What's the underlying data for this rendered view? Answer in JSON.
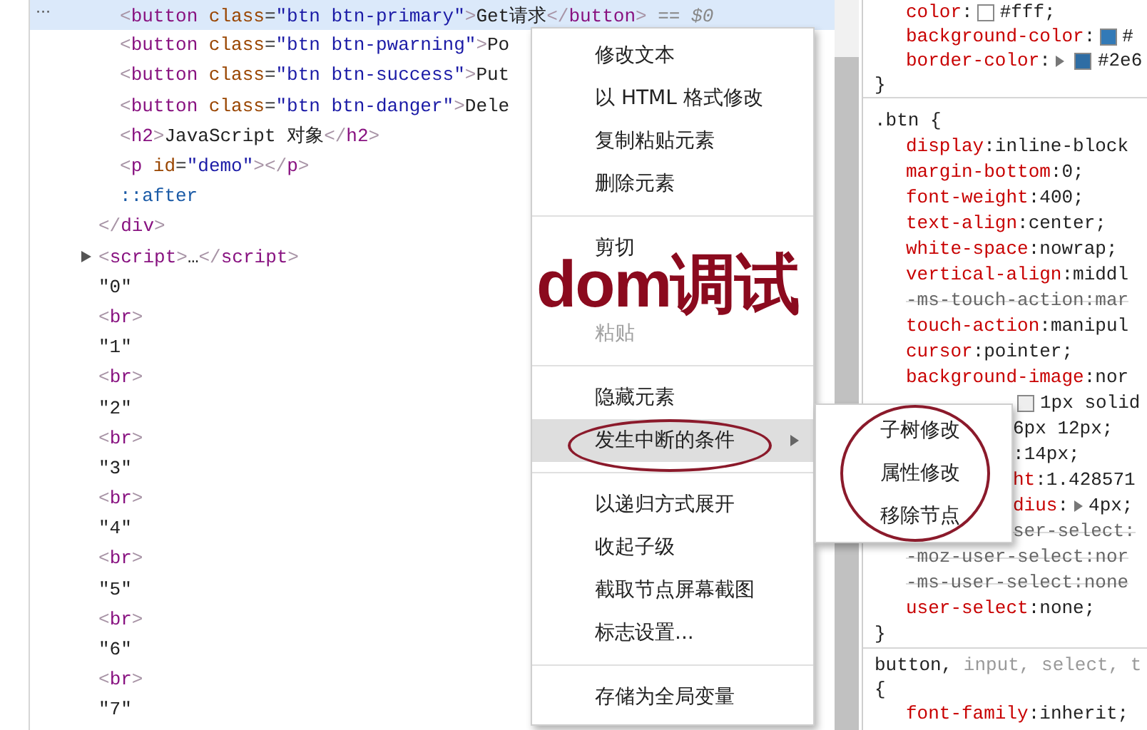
{
  "selected_row_marker": "···",
  "dom_tree": [
    {
      "selected": false,
      "children": [
        {
          "selected": true,
          "segments": [
            {
              "kind": "bracket",
              "text": "<"
            },
            {
              "kind": "tag",
              "text": "button"
            },
            {
              "kind": "attr",
              "text": " class"
            },
            {
              "kind": "punct",
              "text": "="
            },
            {
              "kind": "value",
              "text": "\"btn btn-primary\""
            },
            {
              "kind": "bracket",
              "text": ">"
            },
            {
              "kind": "text",
              "text": "Get请求"
            },
            {
              "kind": "bracket",
              "text": "</"
            },
            {
              "kind": "tag",
              "text": "button"
            },
            {
              "kind": "bracket",
              "text": ">"
            },
            {
              "kind": "note",
              "text": " == $0"
            }
          ]
        },
        {
          "selected": false,
          "segments": [
            {
              "kind": "bracket",
              "text": "<"
            },
            {
              "kind": "tag",
              "text": "button"
            },
            {
              "kind": "attr",
              "text": " class"
            },
            {
              "kind": "punct",
              "text": "="
            },
            {
              "kind": "value",
              "text": "\"btn btn-pwarning\""
            },
            {
              "kind": "bracket",
              "text": ">"
            },
            {
              "kind": "text",
              "text": "Po"
            }
          ]
        },
        {
          "selected": false,
          "segments": [
            {
              "kind": "bracket",
              "text": "<"
            },
            {
              "kind": "tag",
              "text": "button"
            },
            {
              "kind": "attr",
              "text": " class"
            },
            {
              "kind": "punct",
              "text": "="
            },
            {
              "kind": "value",
              "text": "\"btn btn-success\""
            },
            {
              "kind": "bracket",
              "text": ">"
            },
            {
              "kind": "text",
              "text": "Put"
            }
          ]
        },
        {
          "selected": false,
          "segments": [
            {
              "kind": "bracket",
              "text": "<"
            },
            {
              "kind": "tag",
              "text": "button"
            },
            {
              "kind": "attr",
              "text": " class"
            },
            {
              "kind": "punct",
              "text": "="
            },
            {
              "kind": "value",
              "text": "\"btn btn-danger\""
            },
            {
              "kind": "bracket",
              "text": ">"
            },
            {
              "kind": "text",
              "text": "Dele"
            }
          ]
        },
        {
          "selected": false,
          "segments": [
            {
              "kind": "bracket",
              "text": "<"
            },
            {
              "kind": "tag",
              "text": "h2"
            },
            {
              "kind": "bracket",
              "text": ">"
            },
            {
              "kind": "text",
              "text": "JavaScript 对象"
            },
            {
              "kind": "bracket",
              "text": "</"
            },
            {
              "kind": "tag",
              "text": "h2"
            },
            {
              "kind": "bracket",
              "text": ">"
            }
          ]
        },
        {
          "selected": false,
          "segments": [
            {
              "kind": "bracket",
              "text": "<"
            },
            {
              "kind": "tag",
              "text": "p"
            },
            {
              "kind": "attr",
              "text": " id"
            },
            {
              "kind": "punct",
              "text": "="
            },
            {
              "kind": "value",
              "text": "\"demo\""
            },
            {
              "kind": "bracket",
              "text": ">"
            },
            {
              "kind": "bracket",
              "text": "</"
            },
            {
              "kind": "tag",
              "text": "p"
            },
            {
              "kind": "bracket",
              "text": ">"
            }
          ]
        },
        {
          "selected": false,
          "segments": [
            {
              "kind": "pseudo",
              "text": "::after"
            }
          ]
        }
      ],
      "closing": [
        {
          "kind": "bracket",
          "text": "</"
        },
        {
          "kind": "tag",
          "text": "div"
        },
        {
          "kind": "bracket",
          "text": ">"
        }
      ]
    },
    {
      "selected": false,
      "expanded": false,
      "segments": [
        {
          "kind": "bracket",
          "text": "<"
        },
        {
          "kind": "tag",
          "text": "script"
        },
        {
          "kind": "bracket",
          "text": ">"
        },
        {
          "kind": "text",
          "text": "…"
        },
        {
          "kind": "bracket",
          "text": "</"
        },
        {
          "kind": "tag",
          "text": "script"
        },
        {
          "kind": "bracket",
          "text": ">"
        }
      ]
    },
    {
      "selected": false,
      "segments": [
        {
          "kind": "text",
          "text": "\"0\""
        }
      ]
    },
    {
      "selected": false,
      "segments": [
        {
          "kind": "bracket",
          "text": "<"
        },
        {
          "kind": "tag",
          "text": "br"
        },
        {
          "kind": "bracket",
          "text": ">"
        }
      ]
    },
    {
      "selected": false,
      "segments": [
        {
          "kind": "text",
          "text": "\"1\""
        }
      ]
    },
    {
      "selected": false,
      "segments": [
        {
          "kind": "bracket",
          "text": "<"
        },
        {
          "kind": "tag",
          "text": "br"
        },
        {
          "kind": "bracket",
          "text": ">"
        }
      ]
    },
    {
      "selected": false,
      "segments": [
        {
          "kind": "text",
          "text": "\"2\""
        }
      ]
    },
    {
      "selected": false,
      "segments": [
        {
          "kind": "bracket",
          "text": "<"
        },
        {
          "kind": "tag",
          "text": "br"
        },
        {
          "kind": "bracket",
          "text": ">"
        }
      ]
    },
    {
      "selected": false,
      "segments": [
        {
          "kind": "text",
          "text": "\"3\""
        }
      ]
    },
    {
      "selected": false,
      "segments": [
        {
          "kind": "bracket",
          "text": "<"
        },
        {
          "kind": "tag",
          "text": "br"
        },
        {
          "kind": "bracket",
          "text": ">"
        }
      ]
    },
    {
      "selected": false,
      "segments": [
        {
          "kind": "text",
          "text": "\"4\""
        }
      ]
    },
    {
      "selected": false,
      "segments": [
        {
          "kind": "bracket",
          "text": "<"
        },
        {
          "kind": "tag",
          "text": "br"
        },
        {
          "kind": "bracket",
          "text": ">"
        }
      ]
    },
    {
      "selected": false,
      "segments": [
        {
          "kind": "text",
          "text": "\"5\""
        }
      ]
    },
    {
      "selected": false,
      "segments": [
        {
          "kind": "bracket",
          "text": "<"
        },
        {
          "kind": "tag",
          "text": "br"
        },
        {
          "kind": "bracket",
          "text": ">"
        }
      ]
    },
    {
      "selected": false,
      "segments": [
        {
          "kind": "text",
          "text": "\"6\""
        }
      ]
    },
    {
      "selected": false,
      "segments": [
        {
          "kind": "bracket",
          "text": "<"
        },
        {
          "kind": "tag",
          "text": "br"
        },
        {
          "kind": "bracket",
          "text": ">"
        }
      ]
    },
    {
      "selected": false,
      "segments": [
        {
          "kind": "text",
          "text": "\"7\""
        }
      ]
    }
  ],
  "styles": {
    "rules": [
      {
        "declarations": [
          {
            "kind": "full",
            "name": "color",
            "sep": ": ",
            "color": "#ffffff",
            "value": "#fff;",
            "struck": false,
            "expandable": false
          },
          {
            "kind": "full",
            "name": "background-color",
            "sep": ": ",
            "color": "#337ab7",
            "value": "#",
            "struck": false,
            "expandable": false
          },
          {
            "kind": "full",
            "name": "border-color",
            "sep": ":",
            "color": "#2e6da4",
            "value": "#2e6",
            "struck": false,
            "expandable": true
          }
        ],
        "close": "}"
      },
      {
        "selector": [
          {
            "kind": "match",
            "text": ".btn {"
          }
        ],
        "declarations": [
          {
            "kind": "full",
            "name": "display",
            "sep": ": ",
            "value": "inline-block",
            "struck": false,
            "expandable": false
          },
          {
            "kind": "full",
            "name": "margin-bottom",
            "sep": ": ",
            "value": "0;",
            "struck": false,
            "expandable": false
          },
          {
            "kind": "full",
            "name": "font-weight",
            "sep": ": ",
            "value": "400;",
            "struck": false,
            "expandable": false
          },
          {
            "kind": "full",
            "name": "text-align",
            "sep": ": ",
            "value": "center;",
            "struck": false,
            "expandable": false
          },
          {
            "kind": "full",
            "name": "white-space",
            "sep": ": ",
            "value": "nowrap;",
            "struck": false,
            "expandable": false
          },
          {
            "kind": "full",
            "name": "vertical-align",
            "sep": ": ",
            "value": "middl",
            "struck": false,
            "expandable": false
          },
          {
            "kind": "full",
            "name": "-ms-touch-action",
            "sep": ": ",
            "value": "mar",
            "struck": true,
            "expandable": false
          },
          {
            "kind": "full",
            "name": "touch-action",
            "sep": ": ",
            "value": "manipul",
            "struck": false,
            "expandable": false
          },
          {
            "kind": "full",
            "name": "cursor",
            "sep": ": ",
            "value": "pointer;",
            "struck": false,
            "expandable": false
          },
          {
            "kind": "full",
            "name": "background-image",
            "sep": ": ",
            "value": "nor",
            "struck": false,
            "expandable": false
          },
          {
            "kind": "covered",
            "value": "1px solid",
            "color": "#eeeeee",
            "struck": false,
            "expandable": false
          },
          {
            "kind": "covered",
            "value": "6px 12px;",
            "struck": false,
            "expandable": false
          },
          {
            "kind": "covered",
            "sep": ": ",
            "value": "14px;",
            "struck": false,
            "expandable": false
          },
          {
            "kind": "covered",
            "name": "ht",
            "sep": ": ",
            "value": "1.428571",
            "struck": false,
            "expandable": false
          },
          {
            "kind": "covered",
            "name": "dius",
            "sep": ":",
            "value": "4px;",
            "struck": false,
            "expandable": true
          },
          {
            "kind": "covered",
            "name": "ser-select",
            "sep": ":",
            "struck": true,
            "expandable": false
          },
          {
            "kind": "full",
            "name": "-moz-user-select",
            "sep": ": ",
            "value": "nor",
            "struck": true,
            "expandable": false
          },
          {
            "kind": "full",
            "name": "-ms-user-select",
            "sep": ": ",
            "value": "none",
            "struck": true,
            "expandable": false
          },
          {
            "kind": "full",
            "name": "user-select",
            "sep": ": ",
            "value": "none;",
            "struck": false,
            "expandable": false
          }
        ],
        "close": "}"
      },
      {
        "selector": [
          {
            "kind": "match",
            "text": "button,"
          },
          {
            "kind": "nomatch",
            "text": " input, select, t"
          }
        ],
        "open": "{",
        "declarations": [
          {
            "kind": "full",
            "name": "font-family",
            "sep": ": ",
            "value": "inherit;",
            "struck": false,
            "expandable": false
          }
        ]
      }
    ]
  },
  "context_menu": {
    "groups": [
      [
        {
          "label": "修改文本",
          "disabled": false,
          "selected": false,
          "circled": false,
          "kind": "action"
        },
        {
          "label": "以 HTML 格式修改",
          "disabled": false,
          "selected": false,
          "circled": false,
          "kind": "action"
        },
        {
          "label": "复制粘贴元素",
          "disabled": false,
          "selected": false,
          "circled": false,
          "kind": "action"
        },
        {
          "label": "删除元素",
          "disabled": false,
          "selected": false,
          "circled": false,
          "kind": "action"
        }
      ],
      [
        {
          "label": "剪切",
          "disabled": false,
          "selected": false,
          "circled": false,
          "kind": "action"
        },
        {
          "selected": false,
          "circled": false,
          "kind": "action"
        },
        {
          "label": "粘贴",
          "disabled": true,
          "selected": false,
          "circled": false,
          "kind": "action"
        }
      ],
      [
        {
          "label": "隐藏元素",
          "disabled": false,
          "selected": false,
          "circled": false,
          "kind": "action"
        },
        {
          "label": "发生中断的条件",
          "disabled": false,
          "selected": true,
          "circled": true,
          "kind": "submenu"
        }
      ],
      [
        {
          "label": "以递归方式展开",
          "disabled": false,
          "selected": false,
          "circled": false,
          "kind": "action"
        },
        {
          "label": "收起子级",
          "disabled": false,
          "selected": false,
          "circled": false,
          "kind": "action"
        },
        {
          "label": "截取节点屏幕截图",
          "disabled": false,
          "selected": false,
          "circled": false,
          "kind": "action"
        },
        {
          "label": "标志设置...",
          "disabled": false,
          "selected": false,
          "circled": false,
          "kind": "action"
        }
      ],
      [
        {
          "label": "存储为全局变量",
          "disabled": false,
          "selected": false,
          "circled": false,
          "kind": "action"
        }
      ]
    ]
  },
  "submenu": {
    "circled": true,
    "items": [
      {
        "label": "子树修改"
      },
      {
        "label": "属性修改"
      },
      {
        "label": "移除节点"
      }
    ]
  },
  "annotation": {
    "text": "dom调试"
  }
}
